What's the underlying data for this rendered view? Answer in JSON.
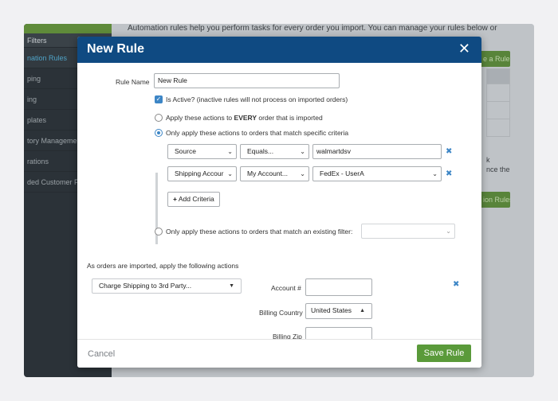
{
  "background": {
    "sidebar": {
      "items": [
        {
          "label": "Filters"
        },
        {
          "label": "nation Rules"
        },
        {
          "label": "ping"
        },
        {
          "label": "ing"
        },
        {
          "label": "plates"
        },
        {
          "label": "tory Manageme"
        },
        {
          "label": "rations"
        },
        {
          "label": "ded Customer Pa"
        }
      ]
    },
    "intro_text": "Automation rules help you perform tasks for every order you import. You can manage your rules below or",
    "create_rule_button": "e a Rule",
    "side_text_1": "k",
    "side_text_2": "nce the",
    "run_rules_button": "ion Rules"
  },
  "modal": {
    "title": "New Rule",
    "close_glyph": "✕",
    "rule_name_label": "Rule Name",
    "rule_name_value": "New Rule",
    "is_active_label": "Is Active? (inactive rules will not process on imported orders)",
    "radio_every_pre": "Apply these actions to ",
    "radio_every_bold": "EVERY",
    "radio_every_post": " order that is imported",
    "radio_specific": "Only apply these actions to orders that match specific criteria",
    "criteria": [
      {
        "field": "Source",
        "operator": "Equals...",
        "value": "walmartdsv"
      },
      {
        "field": "Shipping Accour",
        "operator": "My Account...",
        "value": "FedEx - UserA"
      }
    ],
    "add_criteria": "Add Criteria",
    "radio_filter": "Only apply these actions to orders that match an existing filter:",
    "actions_heading": "As orders are imported, apply the following actions",
    "action_select": "Charge Shipping to 3rd Party...",
    "account_label": "Account #",
    "billing_country_label": "Billing Country",
    "billing_country_value": "United States",
    "billing_zip_label": "Billing Zip",
    "cancel": "Cancel",
    "save": "Save Rule"
  }
}
